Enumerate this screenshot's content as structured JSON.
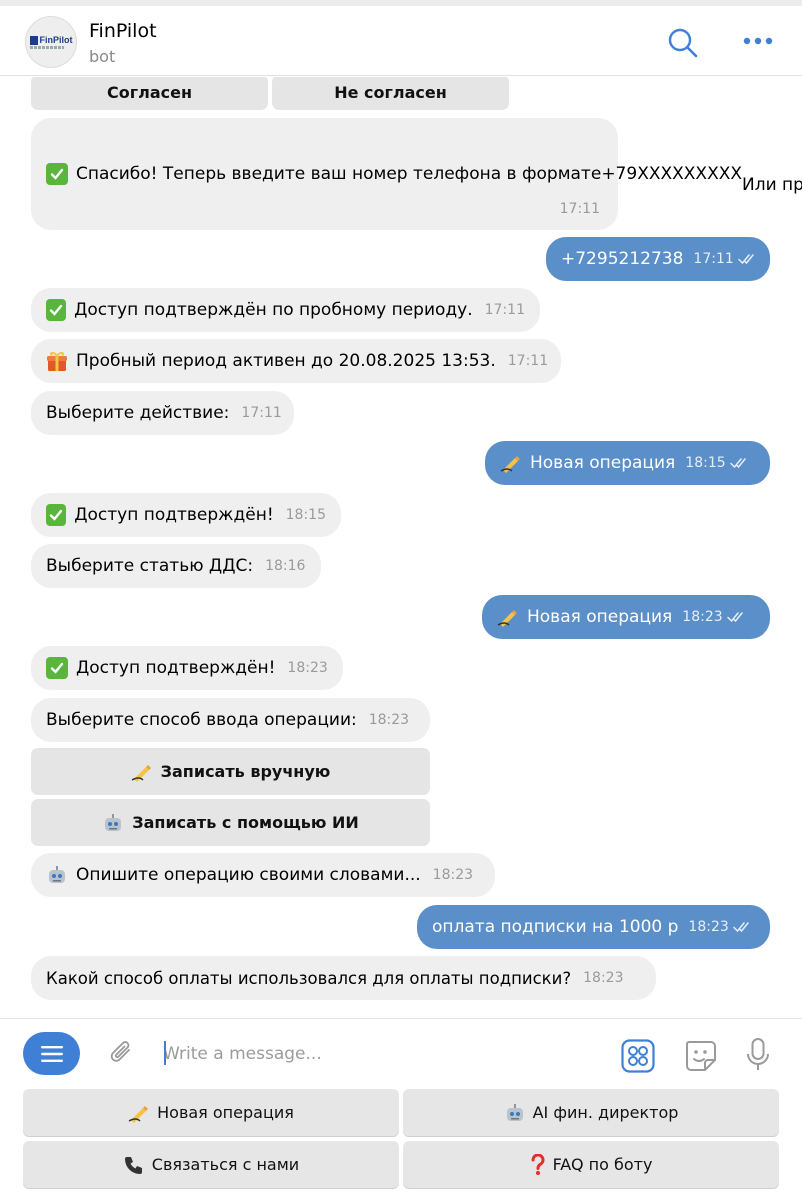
{
  "header": {
    "title": "FinPilot",
    "subtitle": "bot",
    "logo_text": "FinPilot"
  },
  "inline_buttons_top": {
    "agree": "Согласен",
    "disagree": "Не согласен"
  },
  "messages": {
    "m1": {
      "line1": "Спасибо! Теперь введите ваш номер телефона в формате",
      "line2": "+79XXXXXXXXX",
      "line3": "Или просто нажмите кнопку ниже",
      "time": "17:11"
    },
    "m2": {
      "text": "+7295212738",
      "time": "17:11"
    },
    "m3": {
      "text": "Доступ подтверждён по пробному периоду.",
      "time": "17:11"
    },
    "m4": {
      "text": "Пробный период активен до 20.08.2025 13:53.",
      "time": "17:11"
    },
    "m5": {
      "text": "Выберите действие:",
      "time": "17:11"
    },
    "m6": {
      "text": "Новая операция",
      "time": "18:15"
    },
    "m7": {
      "text": "Доступ подтверждён!",
      "time": "18:15"
    },
    "m8": {
      "text": "Выберите статью ДДС:",
      "time": "18:16"
    },
    "m9": {
      "text": "Новая операция",
      "time": "18:23"
    },
    "m10": {
      "text": "Доступ подтверждён!",
      "time": "18:23"
    },
    "m11": {
      "text": "Выберите способ ввода операции:",
      "time": "18:23"
    },
    "m12": {
      "text": "Опишите операцию своими словами...",
      "time": "18:23"
    },
    "m13": {
      "text": "оплата подписки на 1000 р",
      "time": "18:23"
    },
    "m14": {
      "text": "Какой способ оплаты использовался для оплаты подписки?",
      "time": "18:23"
    }
  },
  "inline_buttons_mid": {
    "manual": "Записать вручную",
    "ai": "Записать с помощью ИИ"
  },
  "composer": {
    "placeholder": "Write a message..."
  },
  "keyboard": {
    "new_op": "Новая операция",
    "ai_director": "AI фин. директор",
    "contact": "Связаться с нами",
    "faq": "FAQ по боту"
  },
  "colors": {
    "outgoing_bubble": "#5b8fc9",
    "incoming_bubble": "#efefef",
    "accent": "#3f80d6"
  }
}
